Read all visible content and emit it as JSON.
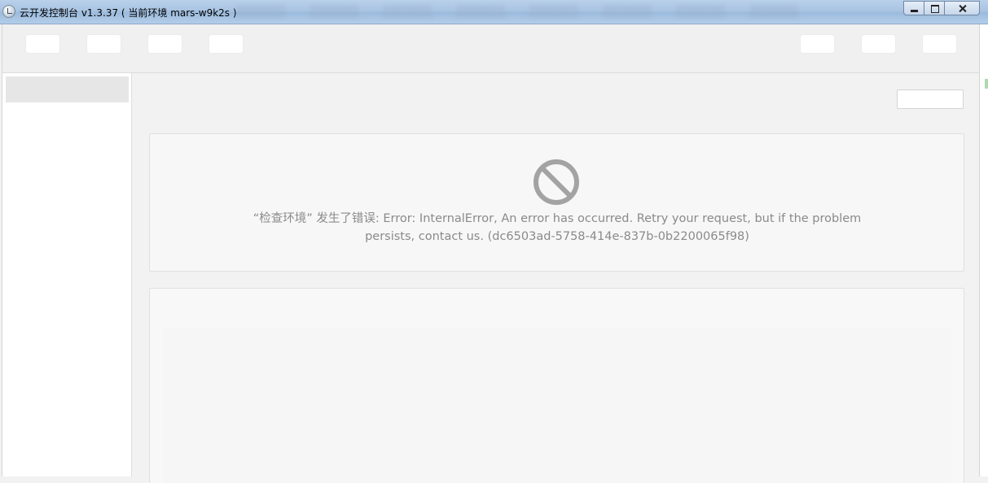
{
  "window": {
    "title": "云开发控制台 v1.3.37 ( 当前环境 mars-w9k2s )",
    "controls": [
      "minimize",
      "maximize",
      "close"
    ]
  },
  "toolbar": {
    "left_buttons": [
      "",
      "",
      "",
      ""
    ],
    "right_buttons": [
      "",
      "",
      ""
    ]
  },
  "sidebar": {
    "items": [
      ""
    ]
  },
  "main": {
    "action_button": "",
    "error": {
      "icon": "ban-icon",
      "message_line1": "“检查环境” 发生了错误: Error: InternalError, An error has occurred. Retry your request, but if the problem",
      "message_line2": "persists, contact us. (dc6503ad-5758-414e-837b-0b2200065f98)"
    }
  },
  "colors": {
    "error_text": "#8a8a8a",
    "icon": "#a3a3a3",
    "background": "#f2f2f2"
  }
}
